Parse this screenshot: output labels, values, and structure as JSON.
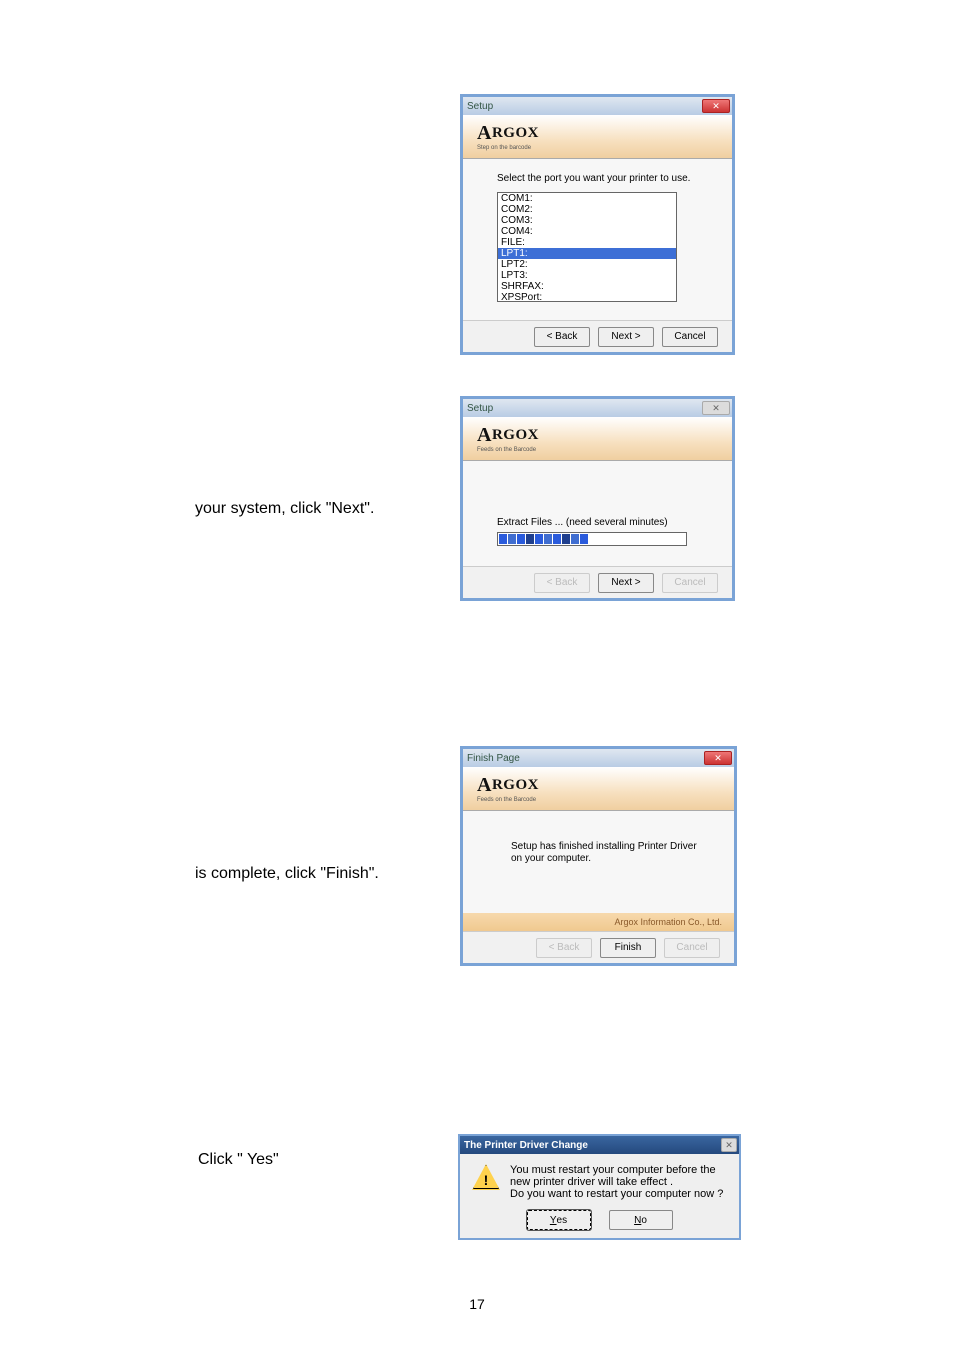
{
  "page_number": "17",
  "captions": {
    "system": "your system, click \"Next\".",
    "complete": "is complete, click \"Finish\".",
    "yes": "Click \" Yes\""
  },
  "dlg1": {
    "title": "Setup",
    "brand": "ARGOX",
    "tagline": "Step on the barcode",
    "label": "Select the port you want your printer to use.",
    "ports": [
      "COM1:",
      "COM2:",
      "COM3:",
      "COM4:",
      "FILE:",
      "LPT1:",
      "LPT2:",
      "LPT3:",
      "SHRFAX:",
      "XPSPort:"
    ],
    "selected_port": "LPT1:",
    "back": "< Back",
    "next": "Next >",
    "cancel": "Cancel"
  },
  "dlg2": {
    "title": "Setup",
    "brand": "ARGOX",
    "tagline": "Feeds on the Barcode",
    "message": "Extract Files ... (need several minutes)",
    "back": "< Back",
    "next": "Next >",
    "cancel": "Cancel"
  },
  "dlg3": {
    "title": "Finish Page",
    "brand": "ARGOX",
    "tagline": "Feeds on the Barcode",
    "message": "Setup has finished installing Printer Driver on your computer.",
    "company": "Argox Information Co., Ltd.",
    "back": "< Back",
    "finish": "Finish",
    "cancel": "Cancel"
  },
  "msgbox": {
    "title": "The Printer Driver Change",
    "line1": "You must restart your computer before the new printer driver will take effect .",
    "line2": "Do you want to restart your computer now ?",
    "yes_label": "Yes",
    "no_label": "No"
  }
}
